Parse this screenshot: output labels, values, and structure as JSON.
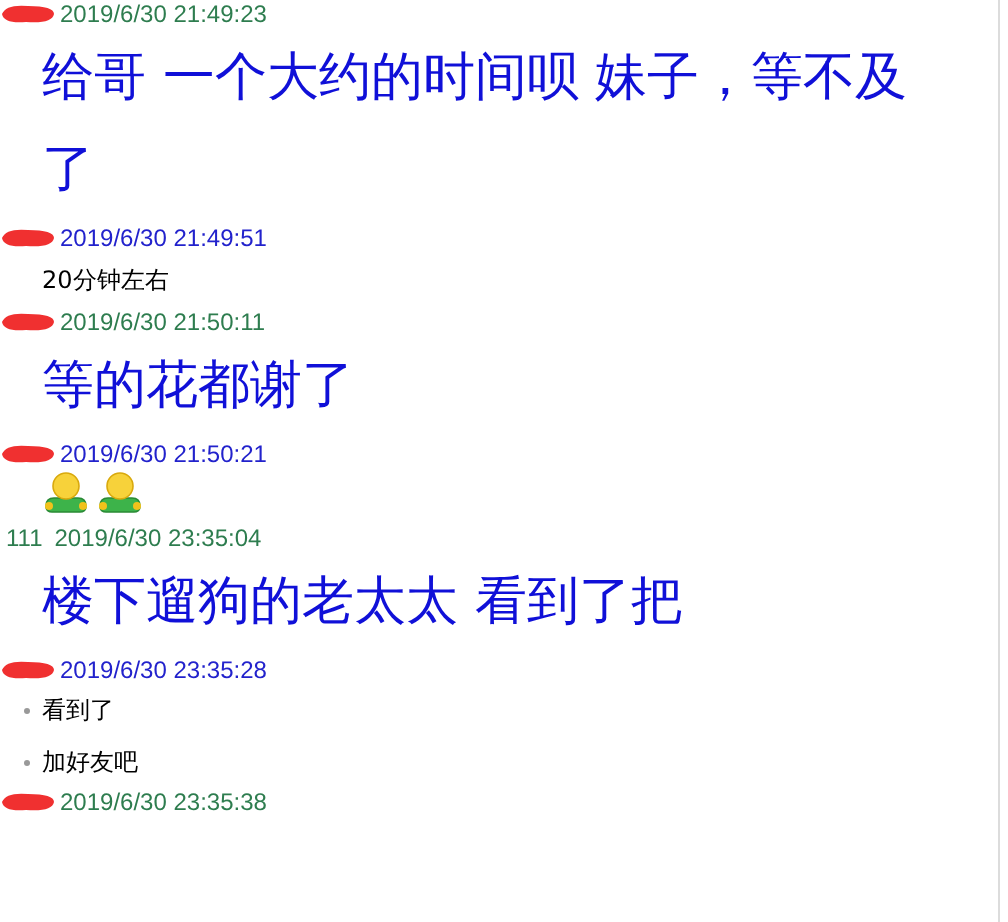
{
  "messages": [
    {
      "header": {
        "redacted": true,
        "time": "2019/6/30 21:49:23",
        "color": "#2e7d4f"
      },
      "body": {
        "kind": "large",
        "text": "给哥 一个大约的时间呗  妹子，等不及了"
      }
    },
    {
      "header": {
        "redacted": true,
        "time": "2019/6/30 21:49:51",
        "color": "#2222cc"
      },
      "body": {
        "kind": "small",
        "lines": [
          "20分钟左右"
        ]
      }
    },
    {
      "header": {
        "redacted": true,
        "time": "2019/6/30 21:50:11",
        "color": "#2e7d4f"
      },
      "body": {
        "kind": "large",
        "text": "等的花都谢了"
      }
    },
    {
      "header": {
        "redacted": true,
        "time": "2019/6/30 21:50:21",
        "color": "#2222cc"
      },
      "body": {
        "kind": "stickers",
        "stickers": [
          {
            "kind": "figure"
          },
          {
            "kind": "figure"
          }
        ]
      }
    },
    {
      "header": {
        "sender": "111",
        "time": "2019/6/30 23:35:04",
        "color": "#2e7d4f"
      },
      "body": {
        "kind": "large",
        "text": "楼下遛狗的老太太 看到了把"
      }
    },
    {
      "header": {
        "redacted": true,
        "time": "2019/6/30 23:35:28",
        "color": "#2222cc"
      },
      "body": {
        "kind": "bullets",
        "lines": [
          "看到了",
          "加好友吧"
        ]
      }
    },
    {
      "header": {
        "redacted": true,
        "time": "2019/6/30 23:35:38",
        "color": "#2e7d4f"
      }
    }
  ]
}
